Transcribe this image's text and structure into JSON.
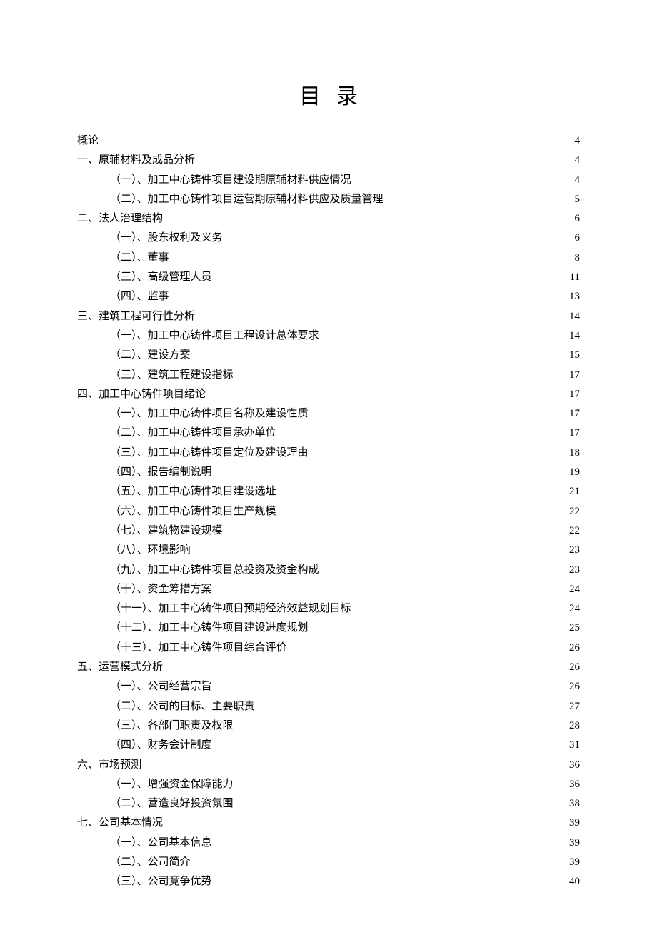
{
  "title": "目录",
  "toc": [
    {
      "level": 0,
      "label": "概论",
      "page": "4"
    },
    {
      "level": 0,
      "label": "一、原辅材料及成品分析",
      "page": "4"
    },
    {
      "level": 1,
      "label": "（一）、加工中心铸件项目建设期原辅材料供应情况",
      "page": "4"
    },
    {
      "level": 1,
      "label": "（二）、加工中心铸件项目运营期原辅材料供应及质量管理",
      "page": "5"
    },
    {
      "level": 0,
      "label": "二、法人治理结构",
      "page": "6"
    },
    {
      "level": 1,
      "label": "（一）、股东权利及义务",
      "page": "6"
    },
    {
      "level": 1,
      "label": "（二）、董事",
      "page": "8"
    },
    {
      "level": 1,
      "label": "（三）、高级管理人员",
      "page": "11"
    },
    {
      "level": 1,
      "label": "（四）、监事",
      "page": "13"
    },
    {
      "level": 0,
      "label": "三、建筑工程可行性分析",
      "page": "14"
    },
    {
      "level": 1,
      "label": "（一）、加工中心铸件项目工程设计总体要求",
      "page": "14"
    },
    {
      "level": 1,
      "label": "（二）、建设方案",
      "page": "15"
    },
    {
      "level": 1,
      "label": "（三）、建筑工程建设指标",
      "page": "17"
    },
    {
      "level": 0,
      "label": "四、加工中心铸件项目绪论",
      "page": "17"
    },
    {
      "level": 1,
      "label": "（一）、加工中心铸件项目名称及建设性质",
      "page": "17"
    },
    {
      "level": 1,
      "label": "（二）、加工中心铸件项目承办单位",
      "page": "17"
    },
    {
      "level": 1,
      "label": "（三）、加工中心铸件项目定位及建设理由",
      "page": "18"
    },
    {
      "level": 1,
      "label": "（四）、报告编制说明",
      "page": "19"
    },
    {
      "level": 1,
      "label": "（五）、加工中心铸件项目建设选址",
      "page": "21"
    },
    {
      "level": 1,
      "label": "（六）、加工中心铸件项目生产规模",
      "page": "22"
    },
    {
      "level": 1,
      "label": "（七）、建筑物建设规模",
      "page": "22"
    },
    {
      "level": 1,
      "label": "（八）、环境影响",
      "page": "23"
    },
    {
      "level": 1,
      "label": "（九）、加工中心铸件项目总投资及资金构成",
      "page": "23"
    },
    {
      "level": 1,
      "label": "（十）、资金筹措方案",
      "page": "24"
    },
    {
      "level": 1,
      "label": "（十一）、加工中心铸件项目预期经济效益规划目标",
      "page": "24"
    },
    {
      "level": 1,
      "label": "（十二）、加工中心铸件项目建设进度规划",
      "page": "25"
    },
    {
      "level": 1,
      "label": "（十三）、加工中心铸件项目综合评价",
      "page": "26"
    },
    {
      "level": 0,
      "label": "五、运营模式分析",
      "page": "26"
    },
    {
      "level": 1,
      "label": "（一）、公司经营宗旨",
      "page": "26"
    },
    {
      "level": 1,
      "label": "（二）、公司的目标、主要职责",
      "page": "27"
    },
    {
      "level": 1,
      "label": "（三）、各部门职责及权限",
      "page": "28"
    },
    {
      "level": 1,
      "label": "（四）、财务会计制度",
      "page": "31"
    },
    {
      "level": 0,
      "label": "六、市场预测",
      "page": "36"
    },
    {
      "level": 1,
      "label": "（一）、增强资金保障能力",
      "page": "36"
    },
    {
      "level": 1,
      "label": "（二）、营造良好投资氛围",
      "page": "38"
    },
    {
      "level": 0,
      "label": "七、公司基本情况",
      "page": "39"
    },
    {
      "level": 1,
      "label": "（一）、公司基本信息",
      "page": "39"
    },
    {
      "level": 1,
      "label": "（二）、公司简介",
      "page": "39"
    },
    {
      "level": 1,
      "label": "（三）、公司竞争优势",
      "page": "40"
    }
  ]
}
